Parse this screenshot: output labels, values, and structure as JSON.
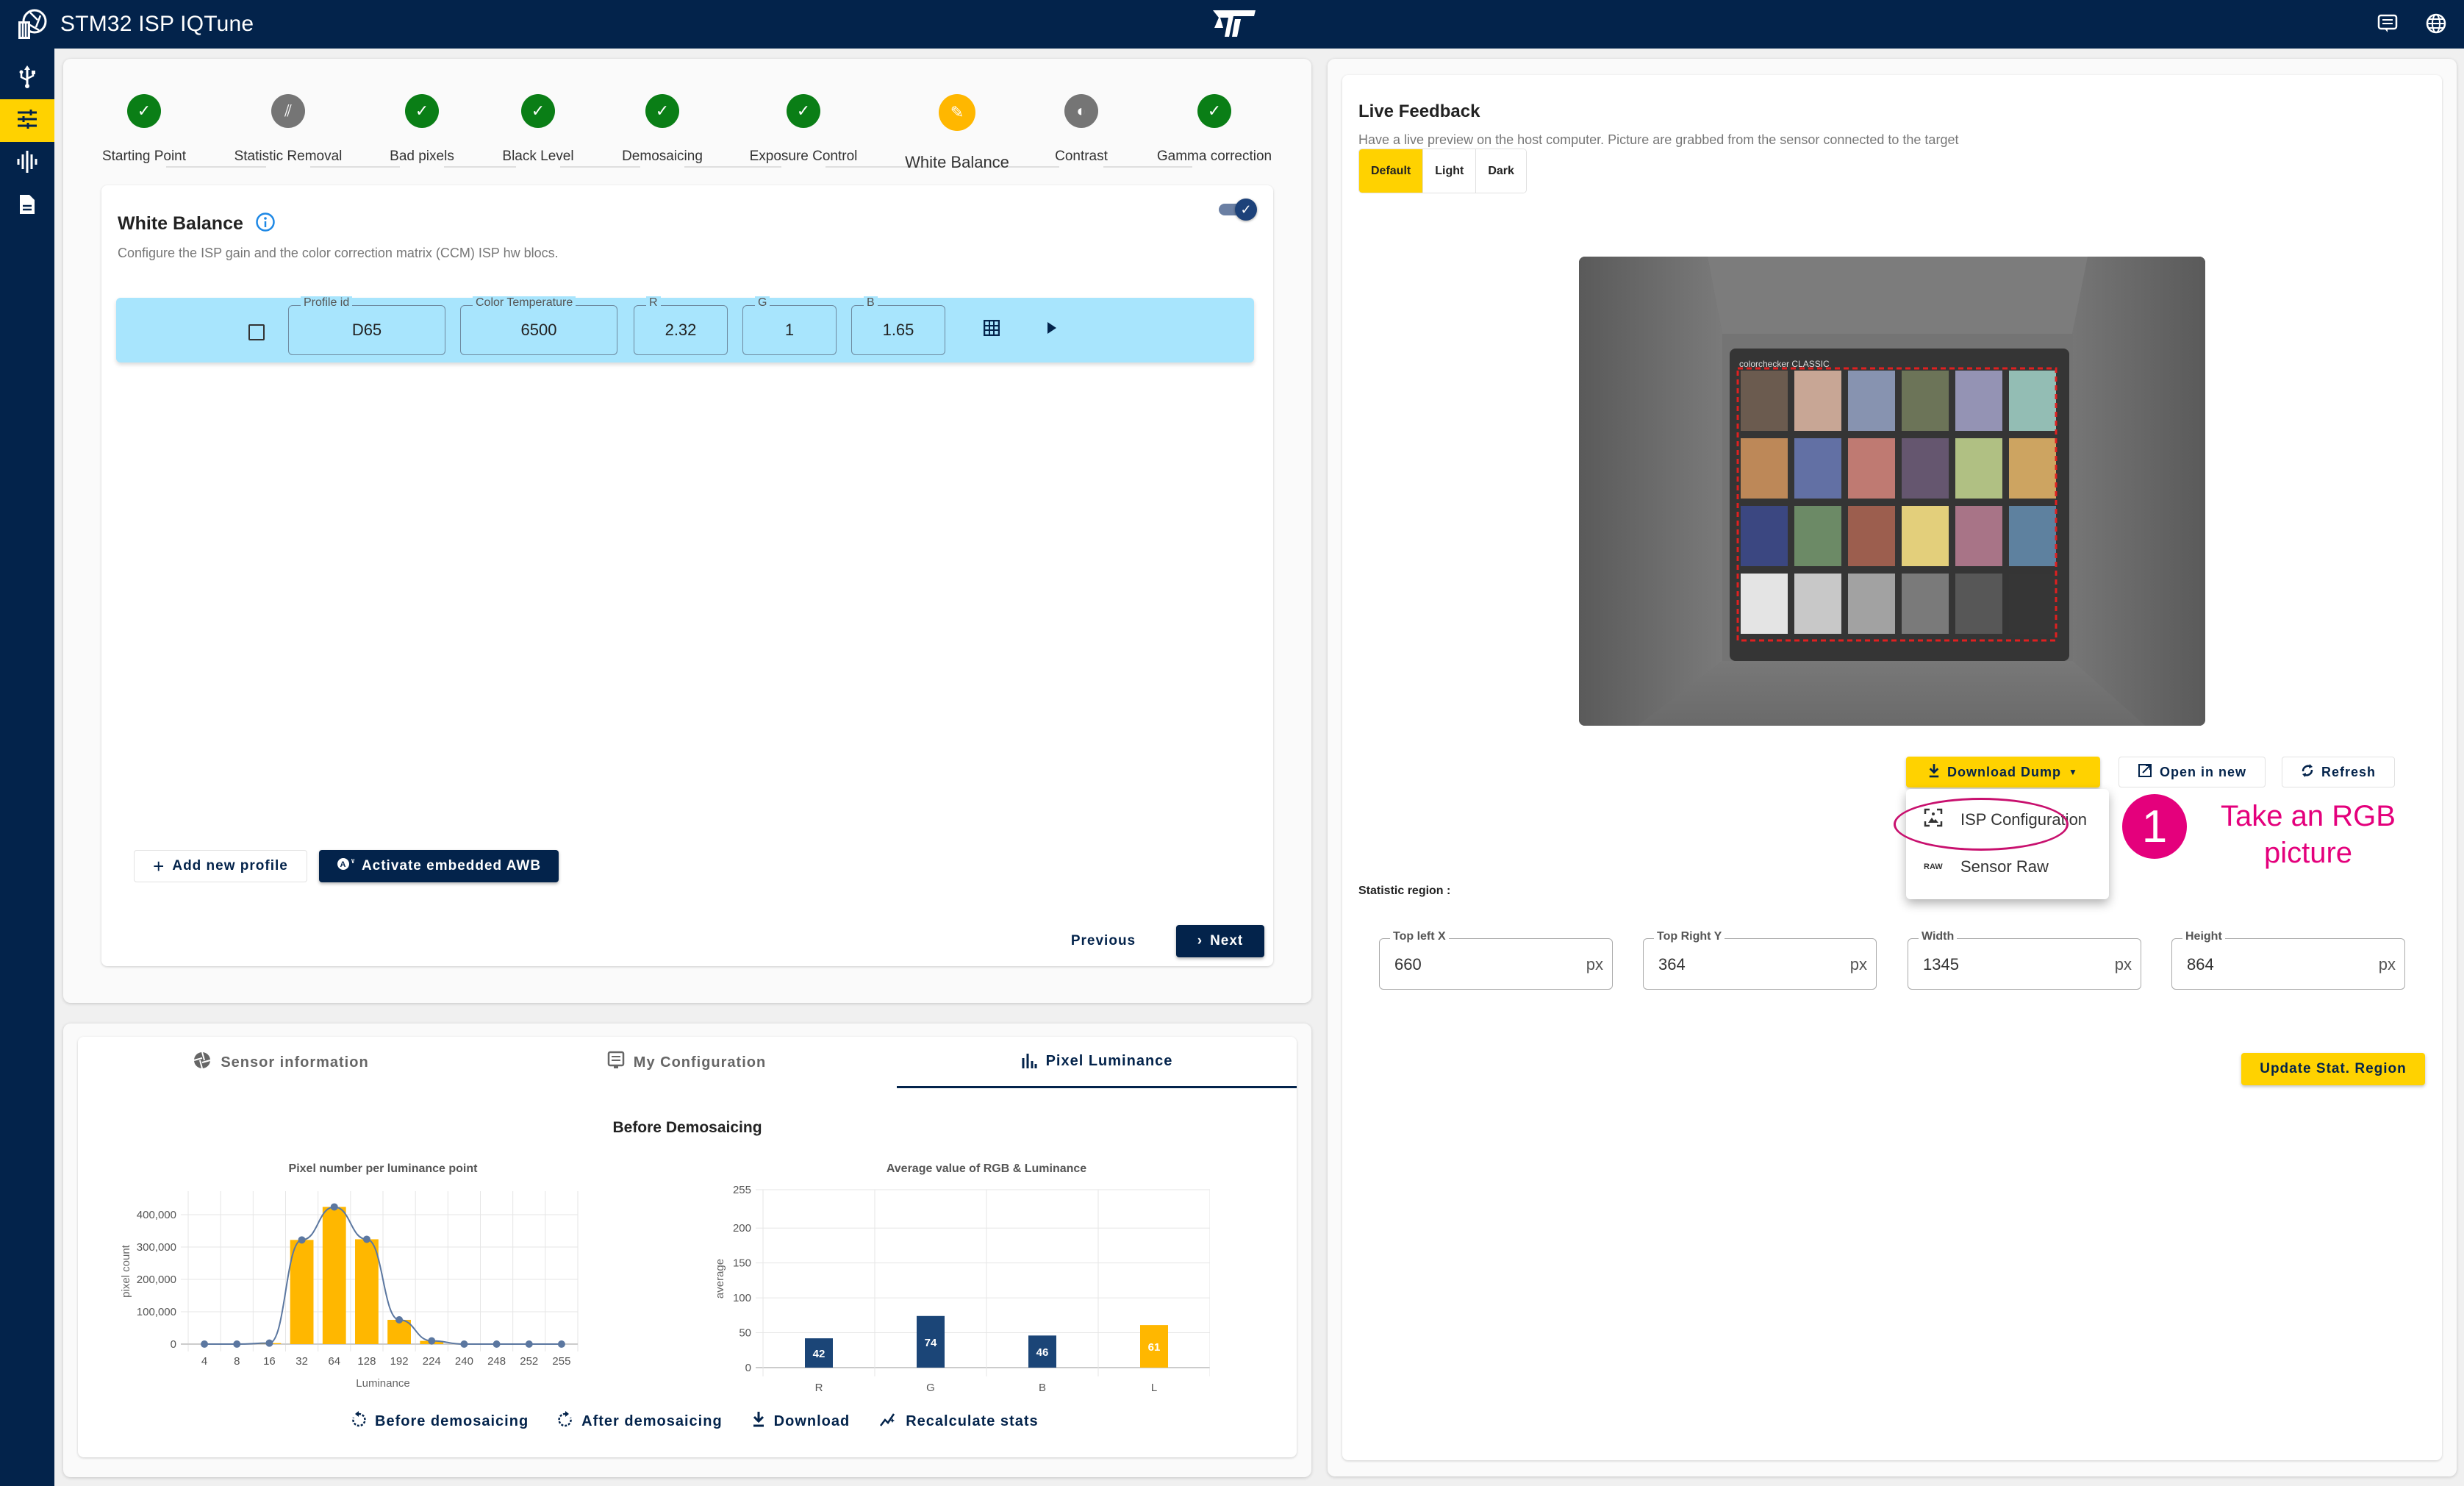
{
  "app": {
    "title": "STM32 ISP IQTune",
    "logo_icon": "camera-aperture-settings-icon",
    "brand_icon": "st-logo",
    "top_icons": [
      "chat-settings-icon",
      "globe-icon"
    ]
  },
  "sidebar": {
    "items": [
      {
        "icon": "usb-icon",
        "active": false
      },
      {
        "icon": "tune-sliders-icon",
        "active": true
      },
      {
        "icon": "waveform-icon",
        "active": false
      },
      {
        "icon": "document-icon",
        "active": false
      }
    ]
  },
  "stepper": {
    "steps": [
      {
        "label": "Starting Point",
        "state": "done"
      },
      {
        "label": "Statistic Removal",
        "state": "skipped"
      },
      {
        "label": "Bad pixels",
        "state": "done"
      },
      {
        "label": "Black Level",
        "state": "done"
      },
      {
        "label": "Demosaicing",
        "state": "done"
      },
      {
        "label": "Exposure Control",
        "state": "done"
      },
      {
        "label": "White Balance",
        "state": "current"
      },
      {
        "label": "Contrast",
        "state": "disabled"
      },
      {
        "label": "Gamma correction",
        "state": "done"
      }
    ]
  },
  "white_balance": {
    "title": "White Balance",
    "description": "Configure the ISP gain and the color correction matrix (CCM) ISP hw blocs.",
    "enabled": true,
    "profile": {
      "selected": false,
      "fields": [
        {
          "label": "Profile id",
          "value": "D65"
        },
        {
          "label": "Color Temperature",
          "value": "6500"
        },
        {
          "label": "R",
          "value": "2.32"
        },
        {
          "label": "G",
          "value": "1"
        },
        {
          "label": "B",
          "value": "1.65"
        }
      ]
    },
    "add_profile_label": "Add new profile",
    "activate_awb_label": "Activate embedded AWB",
    "previous_label": "Previous",
    "next_label": "Next"
  },
  "stats_panel": {
    "tabs": [
      {
        "label": "Sensor information",
        "active": false
      },
      {
        "label": "My Configuration",
        "active": false
      },
      {
        "label": "Pixel Luminance",
        "active": true
      }
    ],
    "section_title": "Before Demosaicing",
    "actions": [
      {
        "label": "Before demosaicing",
        "icon": "rotate-left-icon"
      },
      {
        "label": "After demosaicing",
        "icon": "rotate-right-icon"
      },
      {
        "label": "Download",
        "icon": "download-icon"
      },
      {
        "label": "Recalculate stats",
        "icon": "sparkle-chart-icon"
      }
    ]
  },
  "chart_data": [
    {
      "type": "bar",
      "title": "Pixel number per luminance point",
      "xlabel": "Luminance",
      "ylabel": "pixel count",
      "categories": [
        "4",
        "8",
        "16",
        "32",
        "64",
        "128",
        "192",
        "224",
        "240",
        "248",
        "252",
        "255"
      ],
      "values": [
        0,
        0,
        3000,
        322000,
        424000,
        324000,
        75000,
        10000,
        0,
        0,
        0,
        0
      ],
      "overlay": {
        "type": "line",
        "smooth": true,
        "markers": true,
        "values": [
          0,
          0,
          3000,
          322000,
          424000,
          324000,
          75000,
          10000,
          0,
          0,
          0,
          0
        ]
      },
      "yticks": [
        "0",
        "100,000",
        "200,000",
        "300,000",
        "400,000"
      ],
      "ylim": [
        0,
        450000
      ],
      "grid": true,
      "bar_color": "#ffb700",
      "line_color": "#5b77a0"
    },
    {
      "type": "bar",
      "title": "Average value of RGB & Luminance",
      "xlabel": "",
      "ylabel": "average",
      "categories": [
        "R",
        "G",
        "B",
        "L"
      ],
      "values": [
        42,
        74,
        46,
        61
      ],
      "data_labels": [
        "42",
        "74",
        "46",
        "61"
      ],
      "colors": [
        "#1b4577",
        "#1b4577",
        "#1b4577",
        "#ffb700"
      ],
      "yticks": [
        "0",
        "50",
        "100",
        "150",
        "200",
        "255"
      ],
      "ylim": [
        0,
        255
      ],
      "grid": true
    }
  ],
  "live_feedback": {
    "title": "Live Feedback",
    "description": "Have a live preview on the host computer. Picture are grabbed from the sensor connected to the target",
    "modes": [
      {
        "label": "Default",
        "active": true
      },
      {
        "label": "Light",
        "active": false
      },
      {
        "label": "Dark",
        "active": false
      }
    ],
    "preview_chart_label": "colorchecker CLASSIC",
    "download_dump_label": "Download Dump",
    "open_new_label": "Open in new",
    "refresh_label": "Refresh",
    "dump_menu": [
      {
        "label": "ISP Configuration",
        "icon": "image-frame-icon"
      },
      {
        "label": "Sensor Raw",
        "icon": "raw-icon",
        "icon_text": "RAW"
      }
    ],
    "statistic_region_label": "Statistic region :",
    "stat_fields": [
      {
        "label": "Top left X",
        "value": "660",
        "unit": "px"
      },
      {
        "label": "Top Right Y",
        "value": "364",
        "unit": "px"
      },
      {
        "label": "Width",
        "value": "1345",
        "unit": "px"
      },
      {
        "label": "Height",
        "value": "864",
        "unit": "px"
      }
    ],
    "update_region_label": "Update Stat. Region"
  },
  "annotation": {
    "number": "1",
    "text_line1": "Take an RGB",
    "text_line2": "picture",
    "color": "#e4007c"
  },
  "colors": {
    "navy": "#03234b",
    "yellow": "#ffd200",
    "done_green": "#0a7e16",
    "current_orange": "#ffb700",
    "profile_row": "#a8e5fd"
  }
}
